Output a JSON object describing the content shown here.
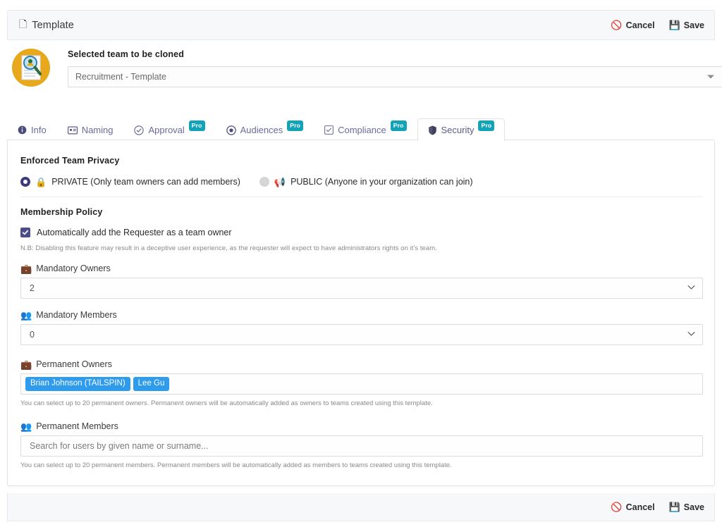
{
  "topbar": {
    "title": "Template",
    "icon": "copy-icon",
    "cancel_label": "Cancel",
    "save_label": "Save",
    "cancel_icon": "no-entry-icon",
    "save_icon": "floppy-disk-icon"
  },
  "header": {
    "logo_icon": "document-magnifier-logo",
    "label": "Selected team to be cloned",
    "selected_team": "Recruitment - Template",
    "caret_icon": "caret-down-icon"
  },
  "tabs": [
    {
      "label": "Info",
      "icon": "info-circle-icon",
      "pro": false,
      "active": false
    },
    {
      "label": "Naming",
      "icon": "id-card-icon",
      "pro": false,
      "active": false
    },
    {
      "label": "Approval",
      "icon": "check-circle-icon",
      "pro": true,
      "active": false
    },
    {
      "label": "Audiences",
      "icon": "target-icon",
      "pro": true,
      "active": false
    },
    {
      "label": "Compliance",
      "icon": "checkbox-icon",
      "pro": true,
      "active": false
    },
    {
      "label": "Security",
      "icon": "shield-icon",
      "pro": true,
      "active": true
    }
  ],
  "pro_badge_label": "Pro",
  "security": {
    "privacy": {
      "title": "Enforced Team Privacy",
      "options": [
        {
          "label": "PRIVATE (Only team owners can add members)",
          "emoji": "🔐",
          "icon": "lock-icon",
          "selected": true
        },
        {
          "label": "PUBLIC (Anyone in your organization can join)",
          "emoji": "📢",
          "icon": "megaphone-icon",
          "selected": false
        }
      ]
    },
    "membership": {
      "title": "Membership Policy",
      "checkbox_label": "Automatically add the Requester as a team owner",
      "checkbox_checked": true,
      "note": "N.B: Disabling this feature may result in a deceptive user experience, as the requester will expect to have administrators rights on it's team."
    },
    "mandatory_owners": {
      "label": "Mandatory Owners",
      "emoji": "💼",
      "icon": "businessperson-icon",
      "value": "2"
    },
    "mandatory_members": {
      "label": "Mandatory Members",
      "emoji": "👥",
      "icon": "people-icon",
      "value": "0"
    },
    "permanent_owners": {
      "label": "Permanent Owners",
      "emoji": "💼",
      "icon": "businessperson-icon",
      "tags": [
        "Brian Johnson (TAILSPIN)",
        "Lee Gu"
      ],
      "hint": "You can select up to 20 permanent owners. Permanent owners will be automatically added as owners to teams created using this template."
    },
    "permanent_members": {
      "label": "Permanent Members",
      "emoji": "👥",
      "icon": "people-icon",
      "placeholder": "Search for users by given name or surname...",
      "value": "",
      "hint": "You can select up to 20 permanent members. Permanent members will be automatically added as members to teams created using this template."
    }
  },
  "footer": {
    "cancel_label": "Cancel",
    "save_label": "Save"
  },
  "colors": {
    "tab_purple": "#6a6a9c",
    "accent_purple": "#4b4b8e",
    "pro_teal": "#13a3b8",
    "tag_blue": "#2e9bed",
    "bar_bg": "#f7f8fa"
  }
}
